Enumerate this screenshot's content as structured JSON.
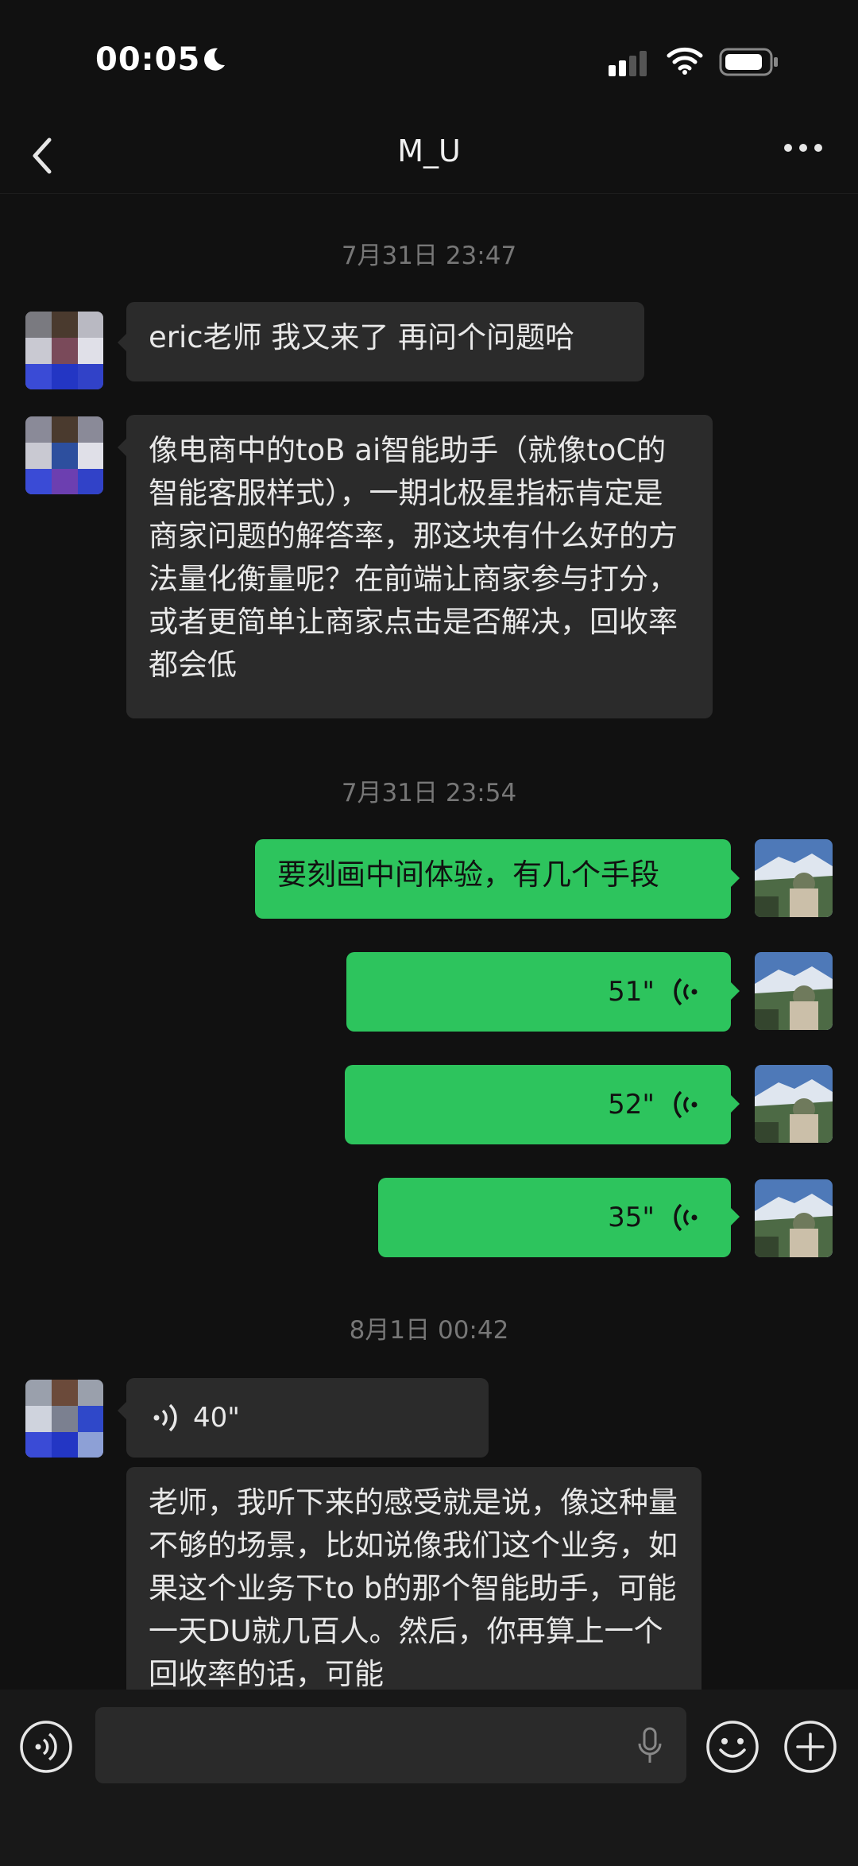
{
  "status_bar": {
    "time": "00:05"
  },
  "nav": {
    "title": "M_U"
  },
  "messages": {
    "t1": "7月31日 23:47",
    "m1": "eric老师 我又来了 再问个问题哈",
    "m2": "像电商中的toB ai智能助手（就像toC的智能客服样式），一期北极星指标肯定是商家问题的解答率，那这块有什么好的方法量化衡量呢？在前端让商家参与打分，或者更简单让商家点击是否解决，回收率都会低",
    "t2": "7月31日 23:54",
    "m3": "要刻画中间体验，有几个手段",
    "v1": "51\"",
    "v2": "52\"",
    "v3": "35\"",
    "t3": "8月1日 00:42",
    "v4": "40\"",
    "m4": "老师，我听下来的感受就是说，像这种量不够的场景，比如说像我们这个业务，如果这个业务下to b的那个智能助手，可能一天DU就几百人。然后，你再算上一个回收率的话，可能"
  },
  "icons": {
    "back": "chevron-left-icon",
    "more": "more-dots-icon",
    "voice_toggle": "voice-mode-icon",
    "mic": "microphone-icon",
    "emoji": "emoji-icon",
    "plus": "plus-icon"
  },
  "colors": {
    "accent_green": "#2dc45d",
    "background": "#111111",
    "incoming_bubble": "#2b2b2b"
  }
}
